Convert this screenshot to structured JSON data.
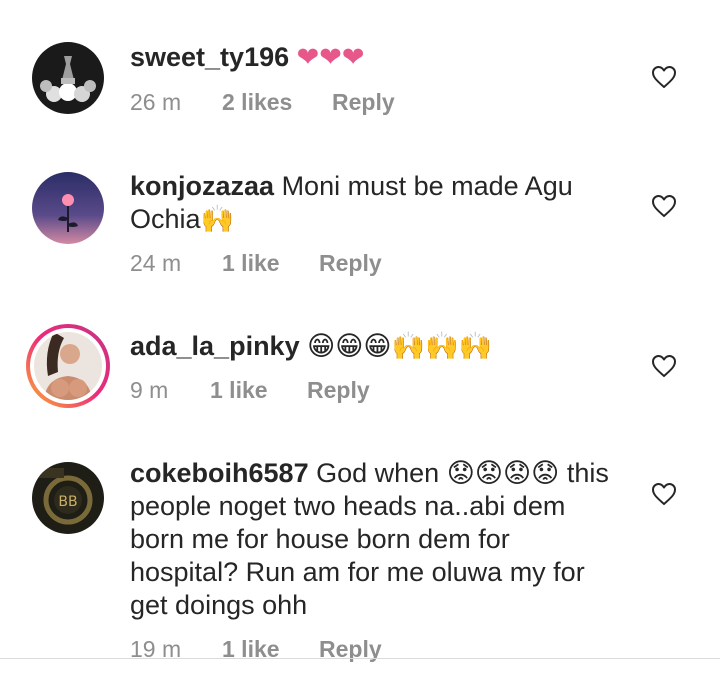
{
  "comments": [
    {
      "username": "sweet_ty196",
      "text": "",
      "emoji": "❤❤❤",
      "time": "26 m",
      "likes": "2 likes",
      "reply": "Reply"
    },
    {
      "username": "konjozazaa",
      "text": "Moni must be made Agu Ochia",
      "emoji": "🙌",
      "time": "24 m",
      "likes": "1 like",
      "reply": "Reply"
    },
    {
      "username": "ada_la_pinky",
      "text": "",
      "emoji": "😁😁😁🙌🙌🙌",
      "time": "9 m",
      "likes": "1 like",
      "reply": "Reply"
    },
    {
      "username": "cokeboih6587",
      "text_line1": "God when",
      "emoji": "😟😟😟😟",
      "text_rest": "this people noget two heads na..abi dem born me for house born dem for hospital? Run am for me oluwa my for get doings ohh",
      "time": "19 m",
      "likes": "1 like",
      "reply": "Reply"
    }
  ],
  "icons": {
    "like": "heart-outline-icon",
    "heart_color": "#e8578a"
  },
  "colors": {
    "text": "#262626",
    "meta": "#8e8e8e",
    "divider": "#dbdbdb"
  }
}
